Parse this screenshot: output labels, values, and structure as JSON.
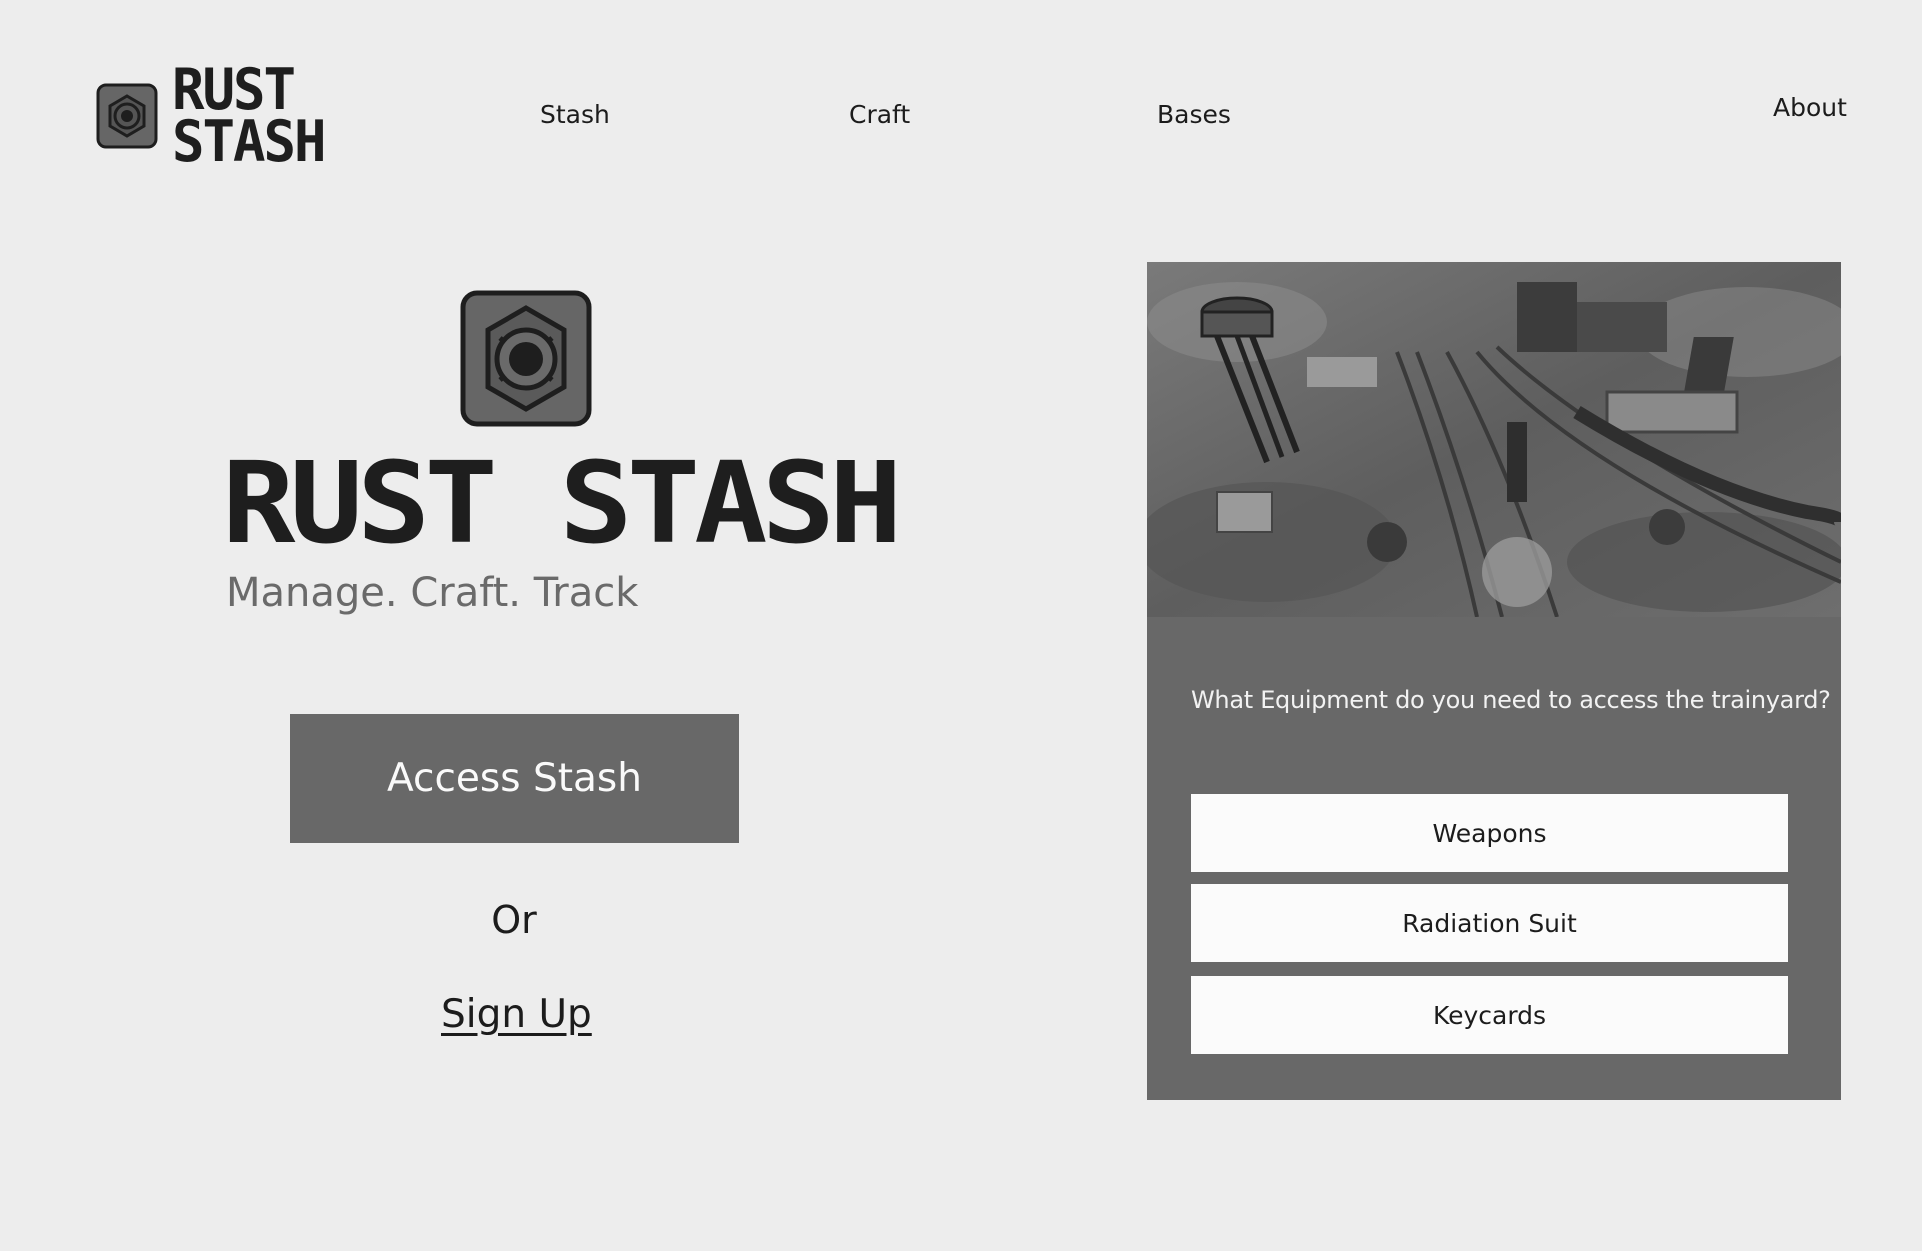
{
  "header": {
    "logo_lines": [
      "RUST",
      "STASH"
    ],
    "nav": {
      "stash": "Stash",
      "craft": "Craft",
      "bases": "Bases",
      "about": "About"
    }
  },
  "hero": {
    "title": "RUST STASH",
    "tagline": "Manage. Craft. Track",
    "access_button": "Access Stash",
    "or_text": "Or",
    "signup_link": "Sign Up"
  },
  "quiz": {
    "image": "aerial view of trainyard",
    "question": "What Equipment do you need to access the trainyard?",
    "answers": [
      "Weapons",
      "Radiation Suit",
      "Keycards"
    ]
  },
  "colors": {
    "background": "#ededed",
    "button": "#686868",
    "text": "#1c1c1c",
    "tagline": "#6a6a6a",
    "answer_bg": "#fbfbfb"
  },
  "icons": {
    "logo": "safe-icon",
    "hero": "safe-icon"
  }
}
